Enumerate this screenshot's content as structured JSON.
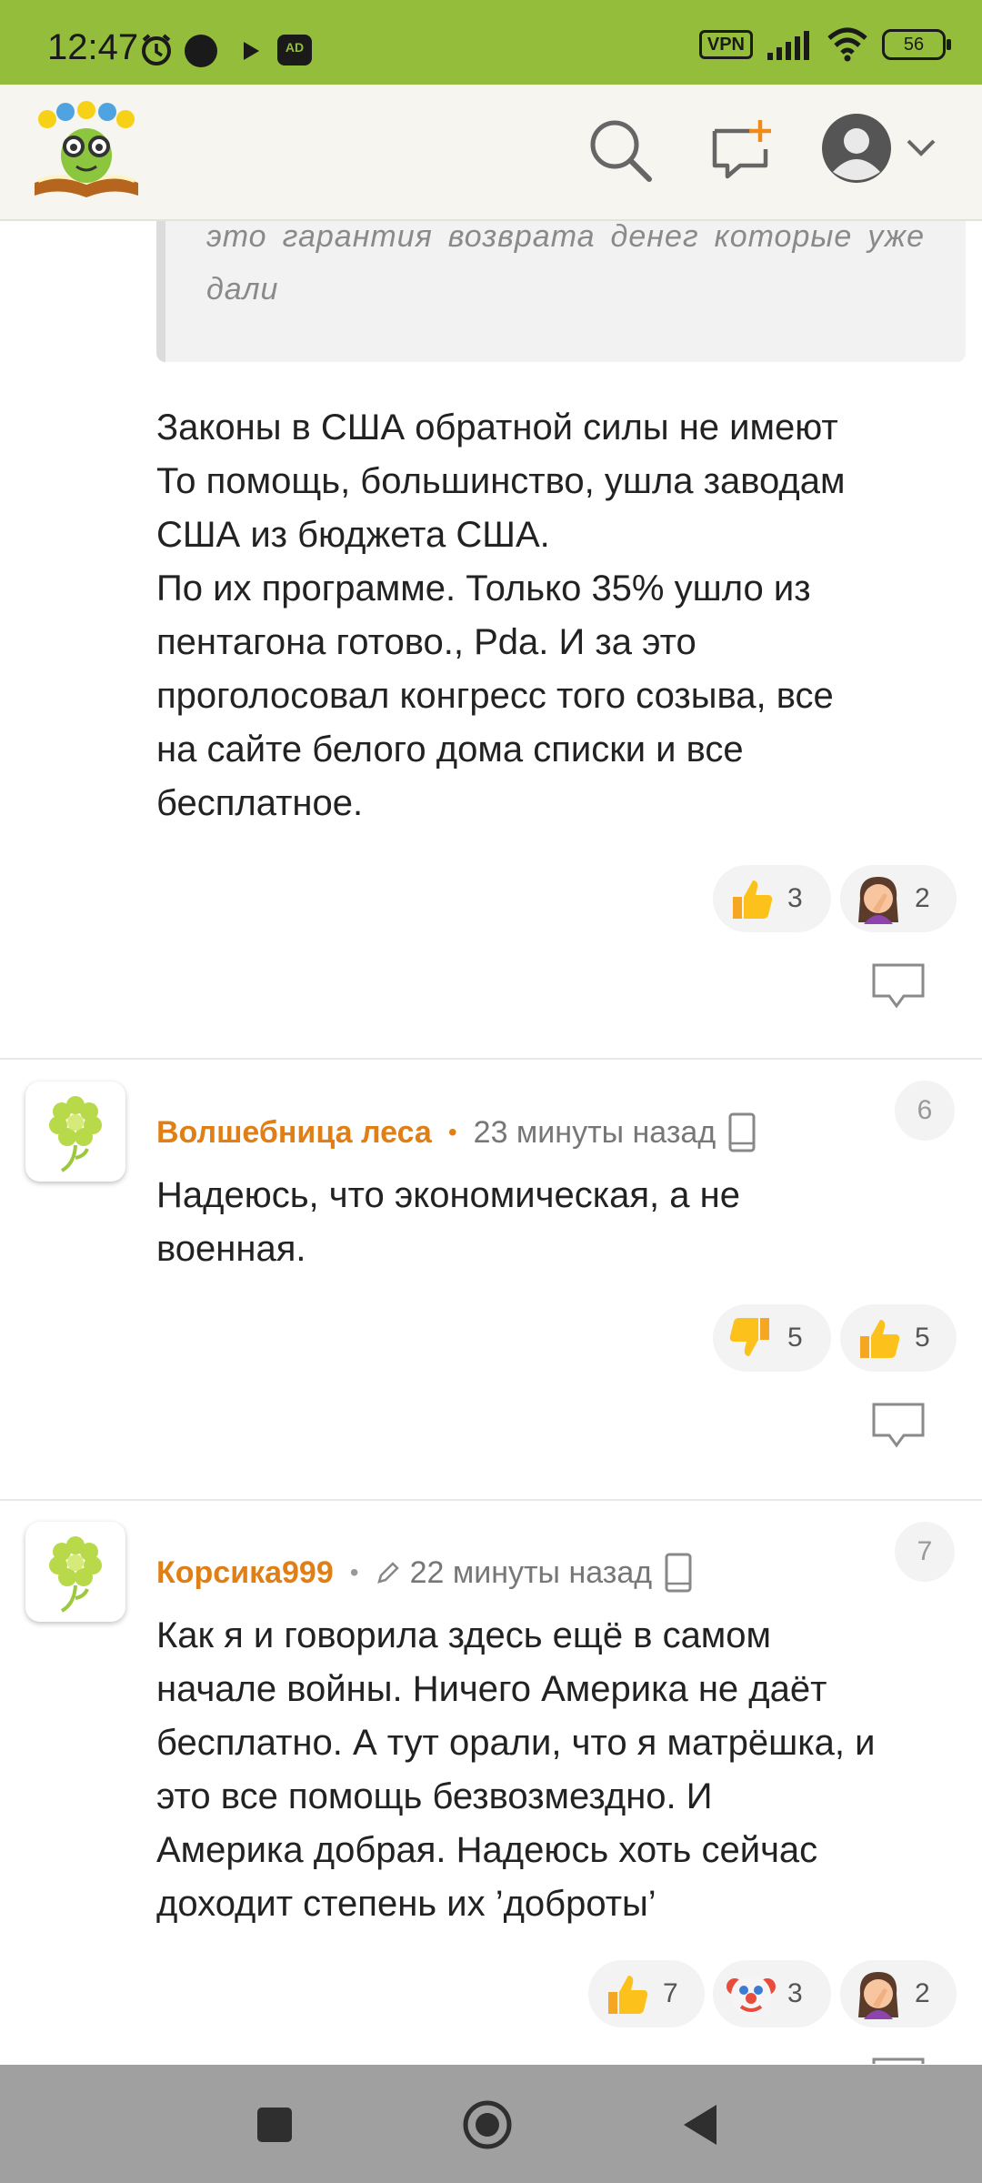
{
  "status_bar": {
    "time": "12:47",
    "vpn": "VPN",
    "battery": "56",
    "ad_badge": "AD"
  },
  "header": {
    "logo": "site-logo",
    "icons": [
      "search-icon",
      "new-post-icon",
      "account-icon",
      "chevron-down-icon"
    ]
  },
  "quote": {
    "text": "это гарантия возврата денег которые уже дали"
  },
  "comments": [
    {
      "text": "Законы в США обратной силы не имеют\nТо помощь, большинство, ушла заводам\nСША из бюджета США.\nПо их программе. Только 35% ушло из\nпентагона готово., Pda. И за это\nпроголосовал конгресс того созыва, все\nна сайте белого дома списки и все\nбесплатное.",
      "reactions": [
        {
          "emoji": "thumbs-up",
          "count": "3"
        },
        {
          "emoji": "facepalm",
          "count": "2"
        }
      ]
    },
    {
      "number": "6",
      "author": "Волшебница леса",
      "time": "23 минуты назад",
      "text": "Надеюсь, что экономическая, а не\nвоенная.",
      "reactions": [
        {
          "emoji": "thumbs-down",
          "count": "5"
        },
        {
          "emoji": "thumbs-up",
          "count": "5"
        }
      ]
    },
    {
      "number": "7",
      "author": "Корсика999",
      "time": "22 минуты назад",
      "edited": true,
      "text": "Как я и говорила здесь ещё в самом\nначале войны. Ничего Америка не даёт\nбесплатно. А тут орали, что я матрёшка, и\nэто все помощь безвозмездно. И\nАмерика добрая. Надеюсь хоть сейчас\nдоходит степень их ’доброты’",
      "reactions": [
        {
          "emoji": "thumbs-up",
          "count": "7"
        },
        {
          "emoji": "clown",
          "count": "3"
        },
        {
          "emoji": "facepalm",
          "count": "2"
        }
      ]
    }
  ],
  "colors": {
    "status_bar": "#93bd3a",
    "author": "#e07f16",
    "header_bg": "#f6f5ef",
    "nav_bar": "#a0a0a0"
  },
  "nav": {
    "buttons": [
      "recents-button",
      "home-button",
      "back-button"
    ]
  }
}
